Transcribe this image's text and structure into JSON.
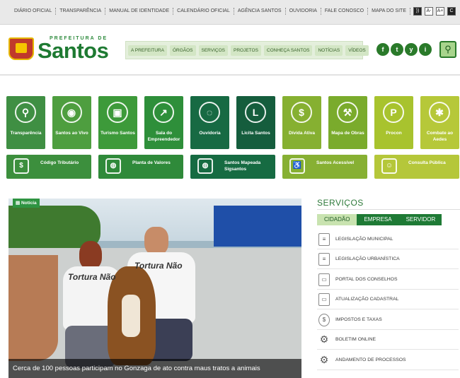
{
  "topbar": {
    "links": [
      "DIÁRIO OFICIAL",
      "TRANSPARÊNCIA",
      "MANUAL DE IDENTIDADE",
      "CALENDÁRIO OFICIAL",
      "AGÊNCIA SANTOS",
      "OUVIDORIA",
      "FALE CONOSCO",
      "MAPA DO SITE"
    ],
    "rss_icon": "rss-icon",
    "font_small": "A-",
    "font_large": "A+",
    "contrast": "C"
  },
  "header": {
    "logo_prefeitura": "PREFEITURA DE",
    "logo_santos": "Santos",
    "nav": [
      "A PREFEITURA",
      "ÓRGÃOS",
      "SERVIÇOS",
      "PROJETOS",
      "CONHEÇA SANTOS",
      "NOTÍCIAS",
      "VÍDEOS"
    ],
    "social": [
      "f",
      "t",
      "y",
      "i"
    ],
    "search_icon": "search-icon"
  },
  "tiles": [
    {
      "label": "Transparência",
      "icon": "magnifier-icon",
      "glyph": "⚲",
      "color": "#3f8f43"
    },
    {
      "label": "Santos ao Vivo",
      "icon": "camera-icon",
      "glyph": "◉",
      "color": "#4e9e3f"
    },
    {
      "label": "Turismo Santos",
      "icon": "tram-icon",
      "glyph": "▣",
      "color": "#3d9a3a"
    },
    {
      "label": "Sala do Empreendedor",
      "icon": "chart-up-icon",
      "glyph": "↗",
      "color": "#2e8f3a"
    },
    {
      "label": "Ouvidoria",
      "icon": "speech-icon",
      "glyph": "◌",
      "color": "#176a43"
    },
    {
      "label": "Licita Santos",
      "icon": "cursor-icon",
      "glyph": "L",
      "color": "#155d3d"
    },
    {
      "label": "Dívida Ativa",
      "icon": "dollar-icon",
      "glyph": "$",
      "color": "#86b031"
    },
    {
      "label": "Mapa de Obras",
      "icon": "shovel-icon",
      "glyph": "⚒",
      "color": "#7aab2c"
    },
    {
      "label": "Procon",
      "icon": "procon-icon",
      "glyph": "P",
      "color": "#a8c32e"
    },
    {
      "label": "Combate ao Aedes",
      "icon": "mosquito-icon",
      "glyph": "✱",
      "color": "#b6c839"
    }
  ],
  "wide_tiles": [
    {
      "label": "Código Tributário",
      "icon": "money-icon",
      "glyph": "$",
      "color": "#3c8f3d"
    },
    {
      "label": "Planta de Valores",
      "icon": "globe-icon",
      "glyph": "◍",
      "color": "#2f8a3a"
    },
    {
      "label": "Santos Mapeada Sigsantos",
      "icon": "map-globe-icon",
      "glyph": "◍",
      "color": "#166b42"
    },
    {
      "label": "Santos Acessível",
      "icon": "accessible-icon",
      "glyph": "♿",
      "color": "#87b033"
    },
    {
      "label": "Consulta Pública",
      "icon": "people-icon",
      "glyph": "☺",
      "color": "#b5c73a"
    }
  ],
  "news": {
    "tag": "Notícia",
    "shirt_text": "Tortura Não",
    "caption": "Cerca de 100 pessoas participam no Gonzaga de ato contra maus tratos a animais"
  },
  "services": {
    "title": "SERVIÇOS",
    "tabs": [
      "CIDADÃO",
      "EMPRESA",
      "SERVIDOR"
    ],
    "items": [
      {
        "label": "LEGISLAÇÃO MUNICIPAL",
        "icon": "document-icon",
        "glyph": "≡"
      },
      {
        "label": "LEGISLAÇÃO URBANÍSTICA",
        "icon": "document-icon",
        "glyph": "≡"
      },
      {
        "label": "PORTAL DOS CONSELHOS",
        "icon": "monitor-icon",
        "glyph": "▭"
      },
      {
        "label": "ATUALIZAÇÃO CADASTRAL",
        "icon": "monitor-icon",
        "glyph": "▭"
      },
      {
        "label": "IMPOSTOS E TAXAS",
        "icon": "coin-icon",
        "glyph": "$"
      },
      {
        "label": "BOLETIM ONLINE",
        "icon": "gear-icon",
        "glyph": "⚙"
      },
      {
        "label": "ANDAMENTO DE PROCESSOS",
        "icon": "gear-icon",
        "glyph": "⚙"
      }
    ]
  }
}
